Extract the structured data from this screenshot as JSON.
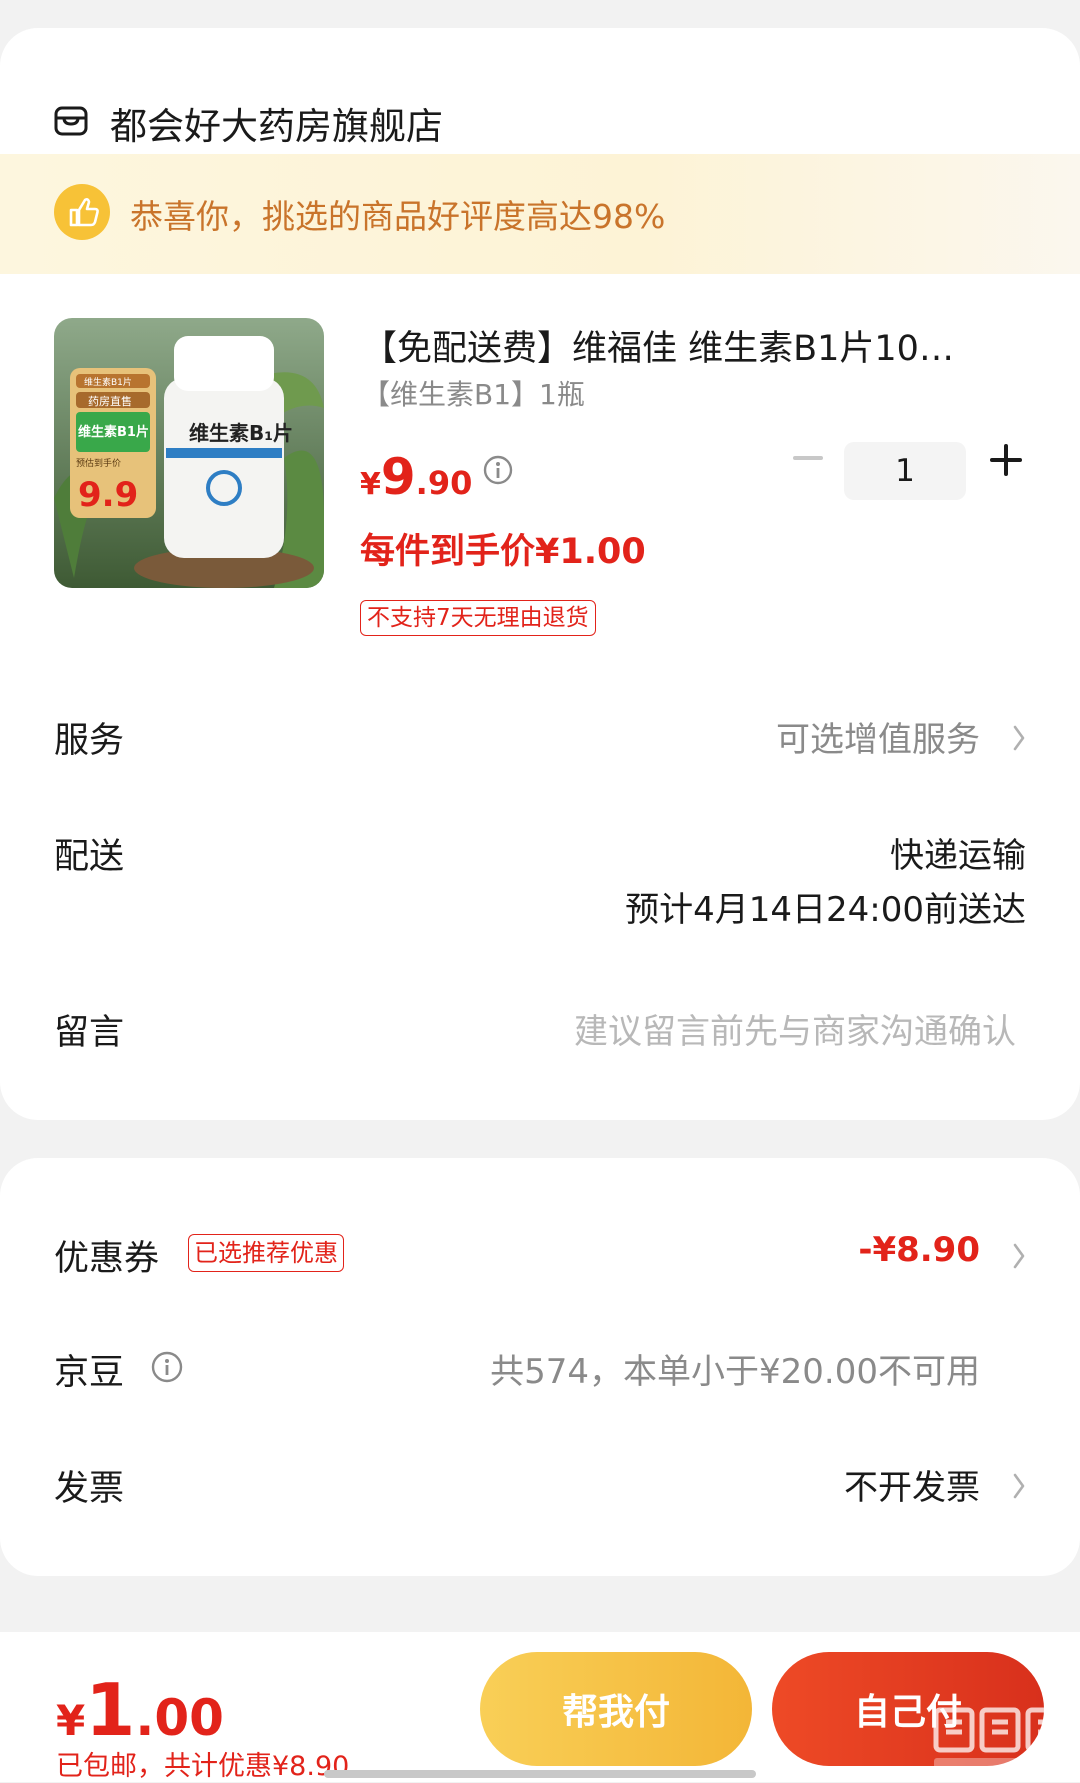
{
  "store": {
    "name": "都会好大药房旗舰店",
    "icon": "store-icon"
  },
  "promo": {
    "text": "恭喜你，挑选的商品好评度高达98%",
    "icon": "thumbs-up-icon"
  },
  "product": {
    "title": "【免配送费】维福佳 维生素B1片10…",
    "spec": "【维生素B1】1瓶",
    "price_symbol": "¥",
    "price_int": "9",
    "price_dec": ".90",
    "net_price": "每件到手价¥1.00",
    "quantity": "1",
    "return_tag": "不支持7天无理由退货",
    "image": {
      "badge_line1": "维生素B1片",
      "badge_line2": "药房直售",
      "badge_main": "维生素B1片",
      "badge_sub": "预估到手价",
      "badge_price": "9.9",
      "bottle_label": "维生素B₁片"
    }
  },
  "rows": {
    "service": {
      "label": "服务",
      "value": "可选增值服务"
    },
    "delivery": {
      "label": "配送",
      "value": "快递运输",
      "eta": "预计4月14日24:00前送达"
    },
    "message": {
      "label": "留言",
      "placeholder": "建议留言前先与商家沟通确认"
    }
  },
  "coupon": {
    "label": "优惠券",
    "tag": "已选推荐优惠",
    "value": "-¥8.90"
  },
  "jingdou": {
    "label": "京豆",
    "value": "共574，本单小于¥20.00不可用"
  },
  "invoice": {
    "label": "发票",
    "value": "不开发票"
  },
  "footer": {
    "total_symbol": "¥",
    "total_int": "1",
    "total_dec": ".00",
    "total_sub": "已包邮，共计优惠¥8.90",
    "help_pay": "帮我付",
    "self_pay": "自己付"
  },
  "colors": {
    "accent": "#e2231a",
    "promo": "#c9742b",
    "help_pay": "#f3b637",
    "self_pay": "#e03a20"
  }
}
